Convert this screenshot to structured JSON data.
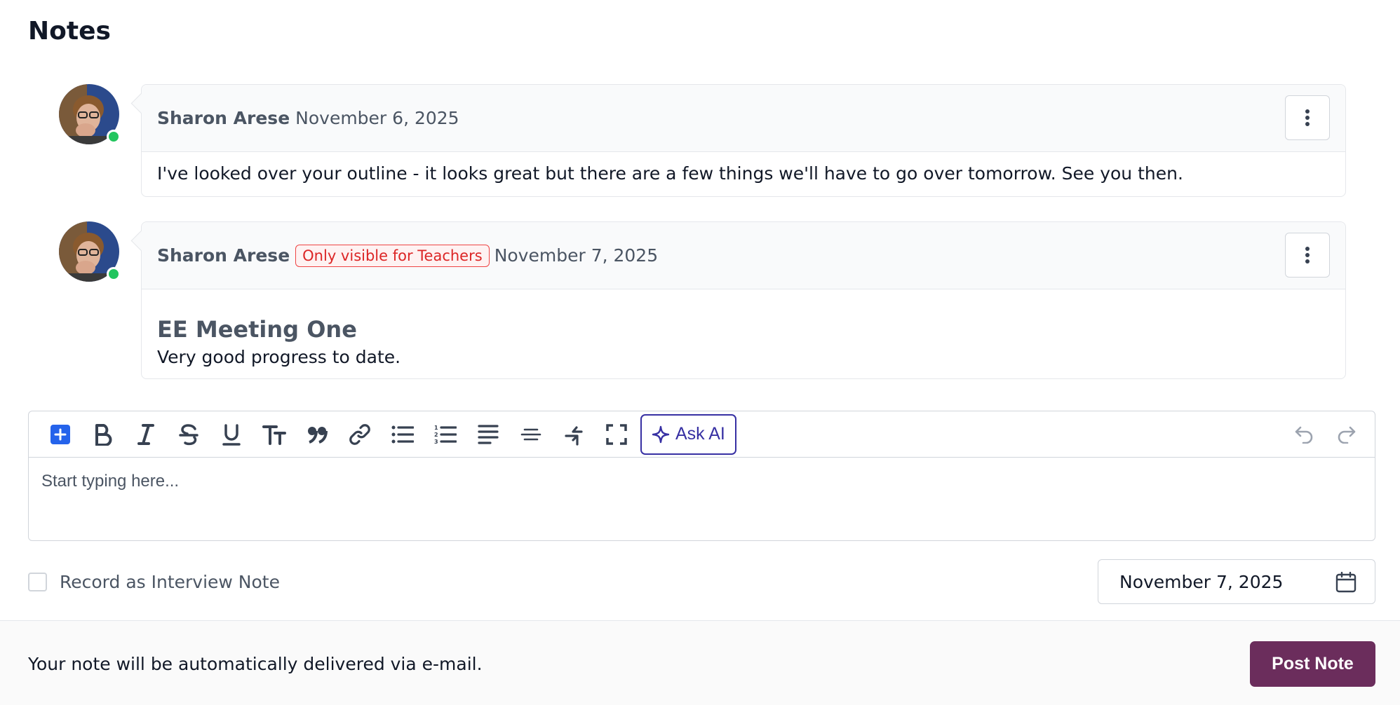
{
  "page": {
    "title": "Notes"
  },
  "notes": [
    {
      "author": "Sharon Arese",
      "badge": "",
      "date": "November 6, 2025",
      "body_heading": "",
      "body_text": "I've looked over your outline - it looks great but there are a few things we'll have to go over tomorrow. See you then.",
      "online": true
    },
    {
      "author": "Sharon Arese",
      "badge": "Only visible for Teachers",
      "date": "November 7, 2025",
      "body_heading": "EE Meeting One",
      "body_text": "Very good progress to date.",
      "online": true
    }
  ],
  "editor": {
    "toolbar": [
      "add-block-icon",
      "bold-icon",
      "italic-icon",
      "strikethrough-icon",
      "underline-icon",
      "text-size-icon",
      "quote-icon",
      "link-icon",
      "bullet-list-icon",
      "numbered-list-icon",
      "align-icon",
      "horizontal-rule-icon",
      "swap-icon",
      "fullscreen-icon"
    ],
    "ask_ai_label": "Ask AI",
    "placeholder": "Start typing here...",
    "value": ""
  },
  "interview_note": {
    "label": "Record as Interview Note",
    "checked": false
  },
  "date_picker": {
    "value": "November 7, 2025"
  },
  "footer": {
    "message": "Your note will be automatically delivered via e-mail.",
    "post_label": "Post Note"
  },
  "colors": {
    "primary": "#6b2d5c",
    "badge_red": "#dc2626",
    "online_green": "#22c55e",
    "ai_indigo": "#3730a3",
    "add_blue": "#2563eb"
  }
}
